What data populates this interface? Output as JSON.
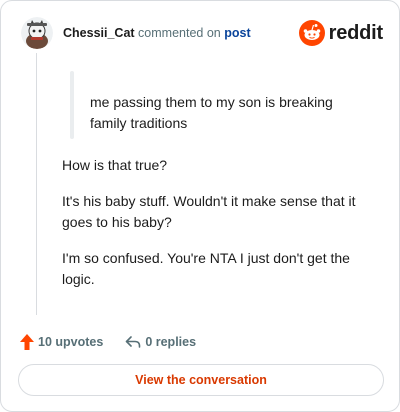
{
  "header": {
    "username": "Chessii_Cat",
    "action_text": "commented on",
    "post_link": "post",
    "brand": "reddit",
    "icons": {
      "avatar": "user-avatar",
      "brand": "reddit-snoo-icon"
    }
  },
  "quote": {
    "text": "me passing them to my son is breaking family traditions"
  },
  "comment": {
    "paragraphs": [
      "How is that true?",
      "It's his baby stuff. Wouldn't it make sense that it goes to his baby?",
      "I'm so confused. You're NTA I just don't get the logic."
    ]
  },
  "actions": {
    "upvotes_label": "10 upvotes",
    "replies_label": "0 replies",
    "icons": {
      "upvote": "upvote-arrow-icon",
      "reply": "reply-arrow-icon"
    }
  },
  "cta": {
    "label": "View the conversation"
  },
  "colors": {
    "accent": "#d93900",
    "upvote": "#ff4500",
    "link": "#0a449b",
    "muted": "#576f76",
    "border": "#d9dce0"
  }
}
